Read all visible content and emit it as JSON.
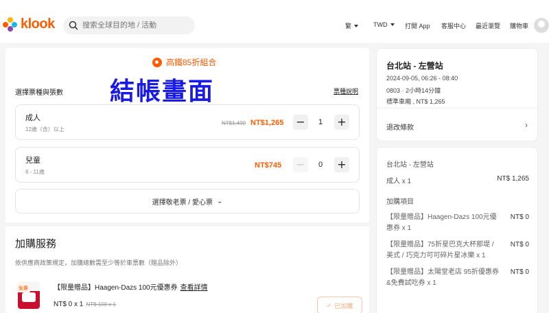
{
  "header": {
    "logo_text": "klook",
    "search_placeholder": "搜索全球目的地 / 活動",
    "language": "繁",
    "currency": "TWD",
    "open_app": "打開 App",
    "help_center": "客服中心",
    "recently_viewed": "最近瀏覽",
    "cart": "購物車"
  },
  "colors": {
    "accent": "#ff5b00",
    "overlay": "#1a1ae6"
  },
  "main": {
    "promo": "高鐵85折組合",
    "overlay_text": "結帳畫面",
    "section_label": "選擇票種與張數",
    "ticket_info_link": "票種說明",
    "tickets": [
      {
        "name": "成人",
        "sub": "12歲（含）以上",
        "old_price": "NT$1,490",
        "price": "NT$1,265",
        "qty": "1"
      },
      {
        "name": "兒童",
        "sub": "6 - 11歲",
        "old_price": "",
        "price": "NT$745",
        "qty": "0"
      }
    ],
    "concession_label": "選擇敬老票 / 愛心票",
    "addon_title": "加購服務",
    "addon_note": "依供應商政策規定，加購總數需至少等於車票數（贈品除外）",
    "addon": {
      "badge": "免費",
      "name": "【限量贈品】Haagen-Dazs 100元優惠券",
      "link": "查看詳情",
      "price": "NT$ 0 x 1",
      "old_price": "NT$ 100 x 1",
      "added_label": "已加購"
    }
  },
  "trip_card": {
    "route": "台北站 - 左營站",
    "datetime": "2024-09-05, 06:26 - 08:40",
    "train": "0803 · 2小時14分鐘",
    "seat": "標準車廂 , NT$ 1,265",
    "refund": "退改條款"
  },
  "summary": {
    "route": "台北站 - 左營站",
    "adult_label": "成人 x 1",
    "adult_price": "NT$ 1,265",
    "addons_label": "加購項目",
    "items": [
      {
        "name": "【限量贈品】Haagen-Dazs 100元優惠券 x 1",
        "price": "NT$ 0"
      },
      {
        "name": "【限量贈品】75折星巴克大杯那堤 / 美式 / 巧克力可可碎片星冰樂 x 1",
        "price": "NT$ 0"
      },
      {
        "name": "【限量贈品】太陽堂老店 95折優惠券&免費試吃券 x 1",
        "price": "NT$ 0"
      }
    ]
  }
}
